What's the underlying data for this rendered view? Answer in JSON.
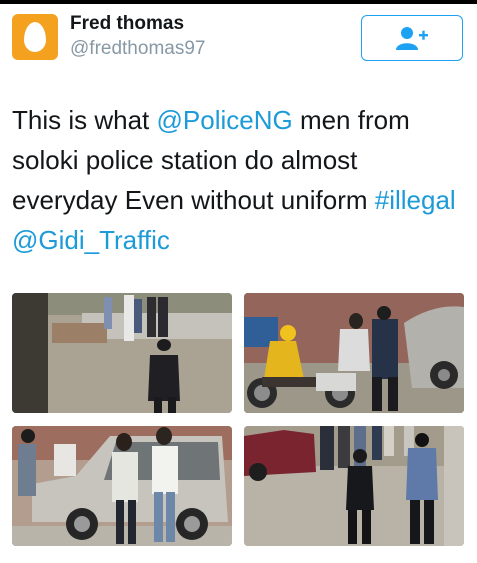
{
  "header": {
    "display_name": "Fred thomas",
    "handle": "@fredthomas97",
    "avatar_icon": "default-egg-avatar",
    "avatar_color": "#f4a11f",
    "follow_icon": "add-user-icon"
  },
  "tweet": {
    "text_before": "This is what ",
    "mention_police": "@PoliceNG",
    "text_middle": " men from soloki police station do almost everyday Even without uniform ",
    "hashtag": "#illegal",
    "space": " ",
    "mention_traffic": "@Gidi_Traffic",
    "link_color": "#1d9bd8"
  },
  "media": {
    "count": 4
  }
}
